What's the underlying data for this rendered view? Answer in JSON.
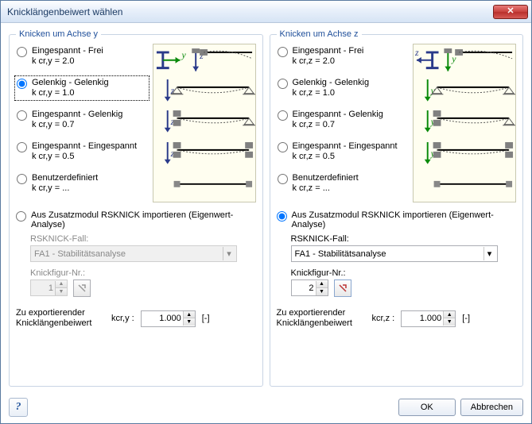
{
  "window": {
    "title": "Knicklängenbeiwert wählen"
  },
  "y": {
    "legend": "Knicken um Achse y",
    "options": [
      {
        "label": "Eingespannt - Frei",
        "coef_html": "k cr,y = 2.0"
      },
      {
        "label": "Gelenkig - Gelenkig",
        "coef_html": "k cr,y = 1.0"
      },
      {
        "label": "Eingespannt - Gelenkig",
        "coef_html": "k cr,y = 0.7"
      },
      {
        "label": "Eingespannt - Eingespannt",
        "coef_html": "k cr,y = 0.5"
      },
      {
        "label": "Benutzerdefiniert",
        "coef_html": "k cr,y = ..."
      }
    ],
    "selected": 1,
    "import_label": "Aus Zusatzmodul RSKNICK importieren (Eigenwert-Analyse)",
    "import_selected": false,
    "case_label": "RSKNICK-Fall:",
    "case_value": "FA1 - Stabilitätsanalyse",
    "mode_label": "Knickfigur-Nr.:",
    "mode_value": "1",
    "export_label": "Zu exportierender Knicklängenbeiwert",
    "export_coef": "kcr,y :",
    "export_value": "1.000",
    "export_unit": "[-]",
    "diag_axis1": "y",
    "diag_axis2": "z"
  },
  "z": {
    "legend": "Knicken um Achse z",
    "options": [
      {
        "label": "Eingespannt - Frei",
        "coef_html": "k cr,z = 2.0"
      },
      {
        "label": "Gelenkig - Gelenkig",
        "coef_html": "k cr,z = 1.0"
      },
      {
        "label": "Eingespannt - Gelenkig",
        "coef_html": "k cr,z = 0.7"
      },
      {
        "label": "Eingespannt - Eingespannt",
        "coef_html": "k cr,z = 0.5"
      },
      {
        "label": "Benutzerdefiniert",
        "coef_html": "k cr,z = ..."
      }
    ],
    "selected": -1,
    "import_label": "Aus Zusatzmodul RSKNICK importieren (Eigenwert-Analyse)",
    "import_selected": true,
    "case_label": "RSKNICK-Fall:",
    "case_value": "FA1 - Stabilitätsanalyse",
    "mode_label": "Knickfigur-Nr.:",
    "mode_value": "2",
    "export_label": "Zu exportierender Knicklängenbeiwert",
    "export_coef": "kcr,z :",
    "export_value": "1.000",
    "export_unit": "[-]",
    "diag_axis1": "z",
    "diag_axis2": "y"
  },
  "footer": {
    "ok": "OK",
    "cancel": "Abbrechen"
  }
}
